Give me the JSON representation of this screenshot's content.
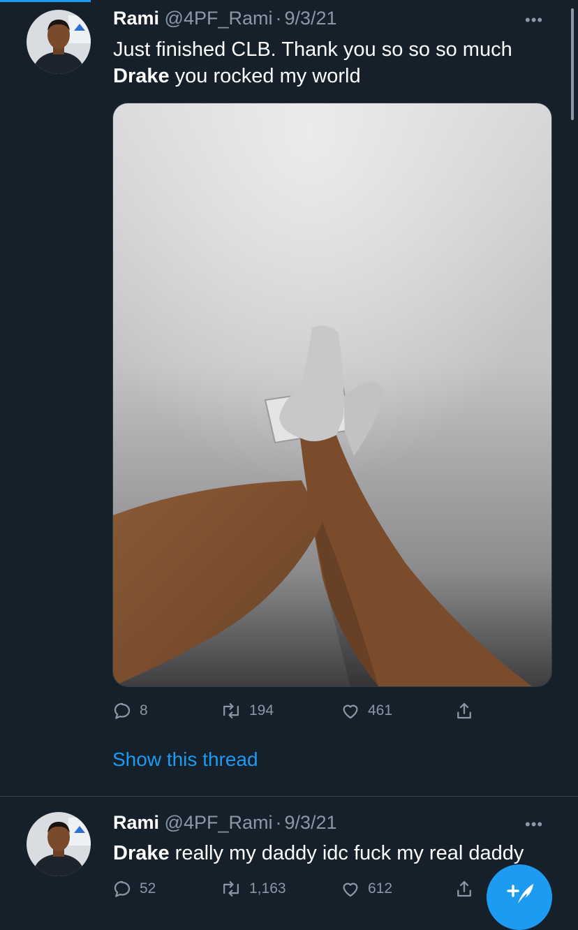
{
  "tweets": [
    {
      "name": "Rami",
      "handle": "@4PF_Rami",
      "sep": "·",
      "date": "9/3/21",
      "text_line1": "Just finished CLB. Thank you so so so much",
      "text_bold": "Drake",
      "text_line2_rest": " you rocked my world",
      "replies": "8",
      "retweets": "194",
      "likes": "461",
      "show_thread": "Show this thread"
    },
    {
      "name": "Rami",
      "handle": "@4PF_Rami",
      "sep": "·",
      "date": "9/3/21",
      "text_bold": "Drake",
      "text_rest": " really my daddy idc fuck my real daddy",
      "replies": "52",
      "retweets": "1,163",
      "likes": "612"
    }
  ],
  "more_label": "•••",
  "icons": {
    "reply": "reply-icon",
    "retweet": "retweet-icon",
    "like": "heart-icon",
    "share": "share-icon",
    "compose": "compose-tweet-icon"
  },
  "colors": {
    "background": "#15202b",
    "accent": "#1d9bf0",
    "secondary_text": "#8b98a5"
  }
}
